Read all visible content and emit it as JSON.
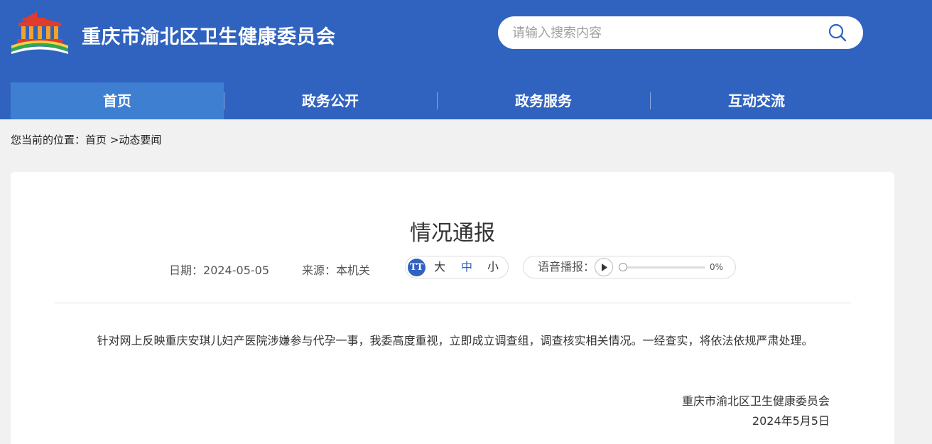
{
  "header": {
    "site_title": "重庆市渝北区卫生健康委员会",
    "logo_icon": "government-building-emblem-icon",
    "search": {
      "placeholder": "请输入搜索内容",
      "value": "",
      "icon": "search-icon"
    }
  },
  "nav": {
    "items": [
      {
        "label": "首页",
        "active": true
      },
      {
        "label": "政务公开",
        "active": false
      },
      {
        "label": "政务服务",
        "active": false
      },
      {
        "label": "互动交流",
        "active": false
      }
    ]
  },
  "breadcrumb": {
    "prefix": "您当前的位置：",
    "home": "首页",
    "separator": ">",
    "current": "动态要闻"
  },
  "article": {
    "title": "情况通报",
    "date_label": "日期：",
    "date": "2024-05-05",
    "source_label": "来源：",
    "source": "本机关",
    "font_size": {
      "icon_text": "TT",
      "options": [
        {
          "label": "大",
          "selected": false
        },
        {
          "label": "中",
          "selected": true
        },
        {
          "label": "小",
          "selected": false
        }
      ]
    },
    "audio": {
      "label": "语音播报：",
      "progress_text": "0%",
      "progress": 0
    },
    "body": "针对网上反映重庆安琪儿妇产医院涉嫌参与代孕一事，我委高度重视，立即成立调查组，调查核实相关情况。一经查实，将依法依规严肃处理。",
    "signature_org": "重庆市渝北区卫生健康委员会",
    "signature_date": "2024年5月5日"
  },
  "colors": {
    "brand_blue": "#3063bf",
    "nav_active": "#3e7fd1",
    "page_bg": "#f1f1f1"
  }
}
